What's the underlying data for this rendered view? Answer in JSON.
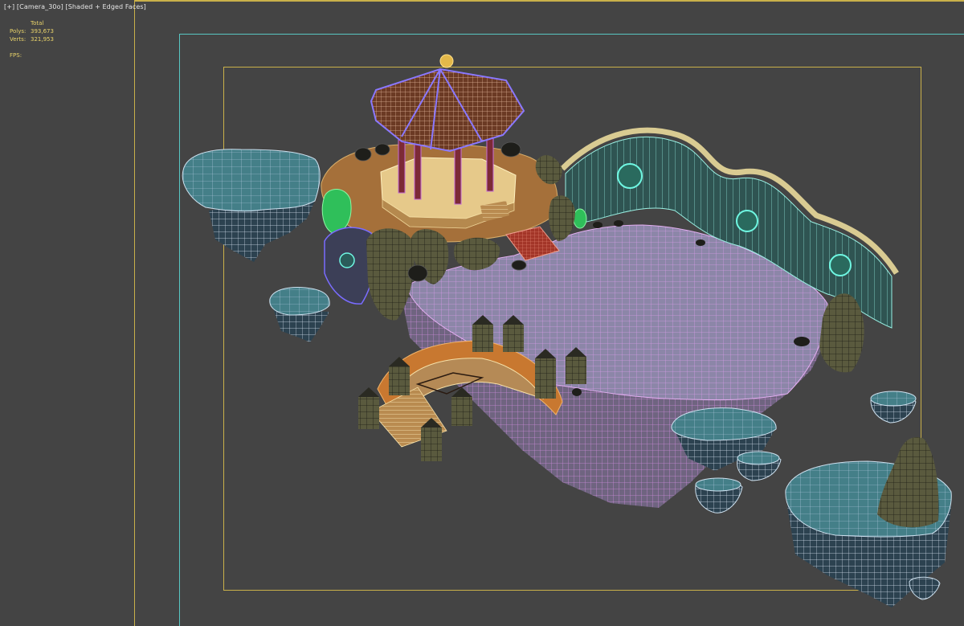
{
  "viewport": {
    "menu_plus": "[+]",
    "camera": "[Camera_30o]",
    "shading": "[Shaded + Edged Faces]"
  },
  "stats": {
    "total_label": "Total",
    "polys_label": "Polys:",
    "polys_value": "393,673",
    "verts_label": "Verts:",
    "verts_value": "321,953",
    "fps_label": "FPS:",
    "fps_value": ""
  },
  "colors": {
    "background": "#444444",
    "safe_frame_live": "#58c6c2",
    "safe_frame_action": "#c9b04a",
    "stats_text": "#e9d36a",
    "wire_lake": "#d08ce0",
    "wire_rock": "#cfd8e8",
    "island_top": "#3f7c82",
    "island_side": "#2e4652"
  },
  "scene": {
    "objects": [
      "pavilion",
      "wave-wall",
      "lake-island",
      "arched-bridge",
      "lanterns",
      "floating-islets",
      "rock-spire",
      "stone-stairs"
    ]
  }
}
